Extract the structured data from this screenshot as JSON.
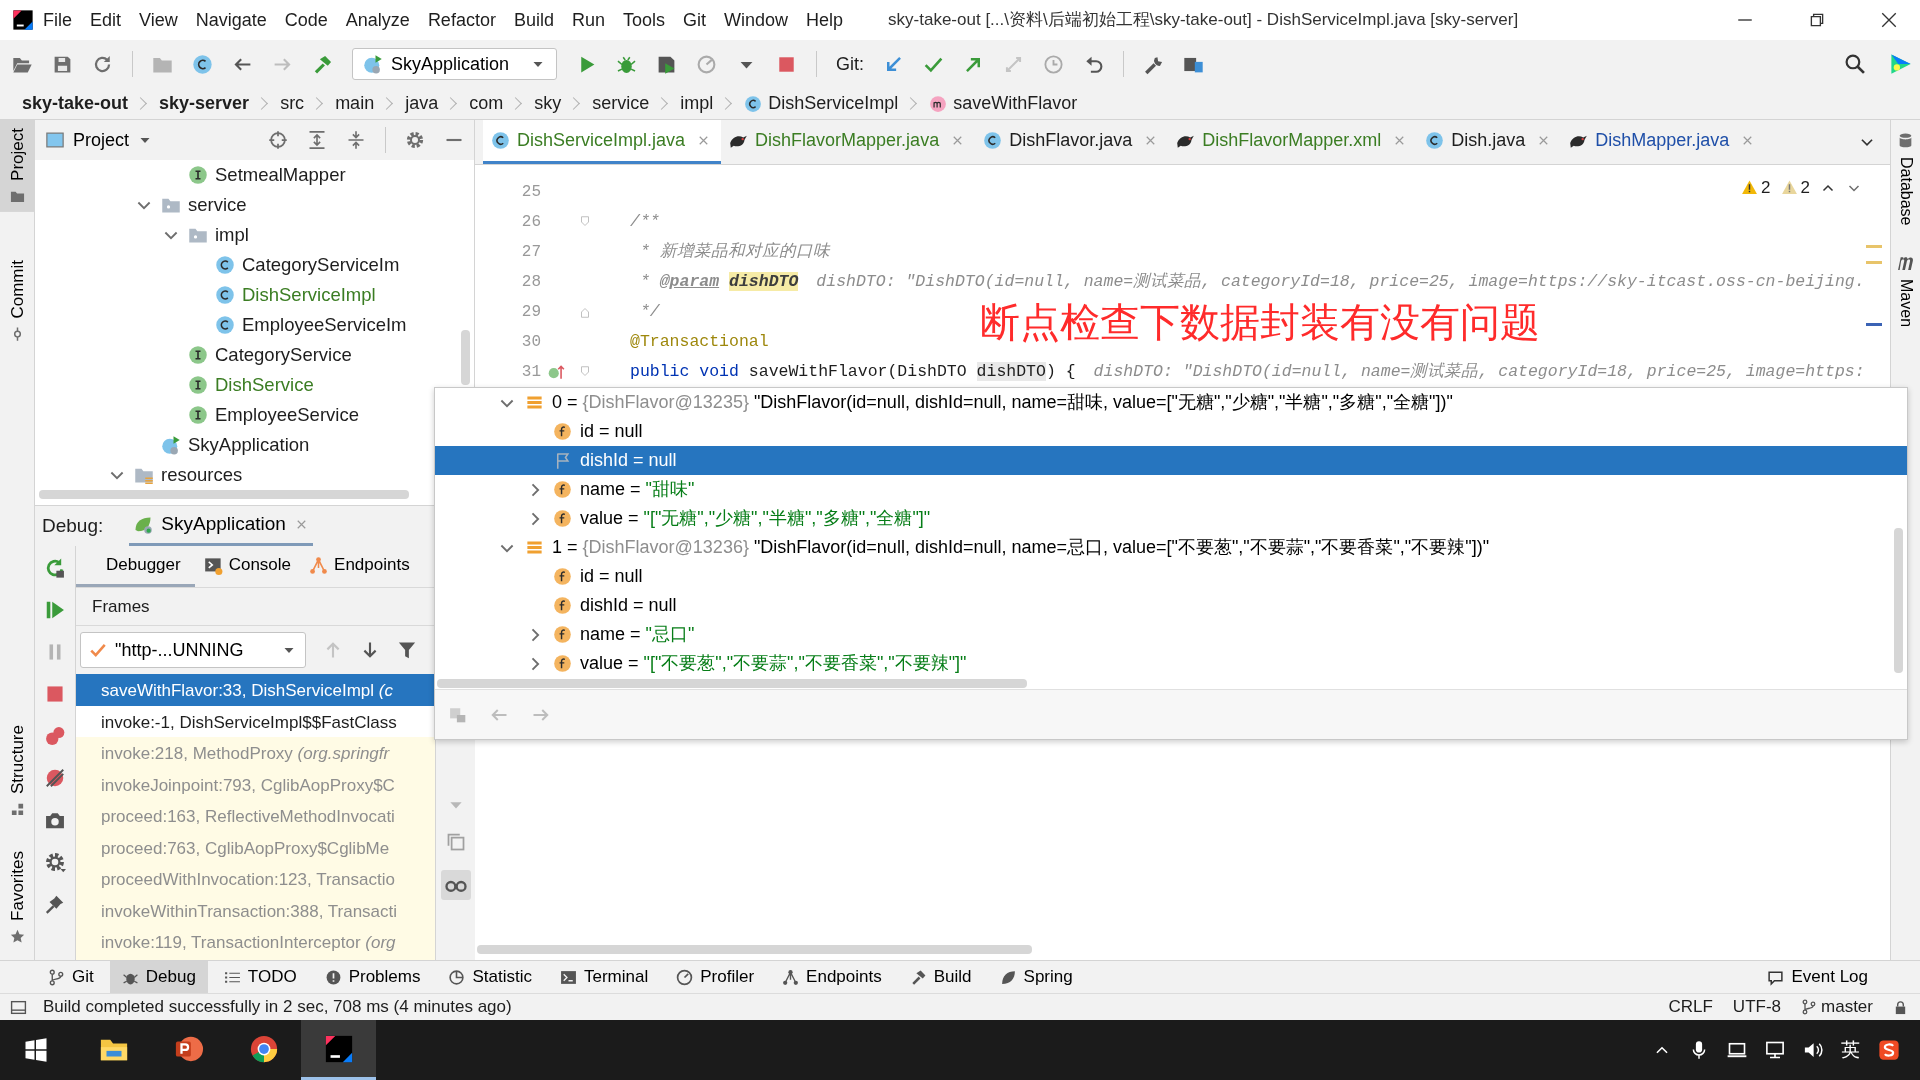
{
  "window": {
    "title": "sky-take-out [...\\资料\\后端初始工程\\sky-take-out] - DishServiceImpl.java [sky-server]"
  },
  "menu": [
    "File",
    "Edit",
    "View",
    "Navigate",
    "Code",
    "Analyze",
    "Refactor",
    "Build",
    "Run",
    "Tools",
    "Git",
    "Window",
    "Help"
  ],
  "toolbar": {
    "run_config": "SkyApplication",
    "git_label": "Git:"
  },
  "breadcrumbs": [
    {
      "label": "sky-take-out",
      "kind": "module"
    },
    {
      "label": "sky-server",
      "kind": "module"
    },
    {
      "label": "src",
      "kind": "folder"
    },
    {
      "label": "main",
      "kind": "folder"
    },
    {
      "label": "java",
      "kind": "folder"
    },
    {
      "label": "com",
      "kind": "folder"
    },
    {
      "label": "sky",
      "kind": "folder"
    },
    {
      "label": "service",
      "kind": "folder"
    },
    {
      "label": "impl",
      "kind": "folder"
    },
    {
      "label": "DishServiceImpl",
      "kind": "class"
    },
    {
      "label": "saveWithFlavor",
      "kind": "method"
    }
  ],
  "left_stripe": {
    "top": [
      {
        "label": "Project",
        "selected": true,
        "kind": "project"
      },
      {
        "label": "Commit",
        "selected": false,
        "kind": "commit"
      }
    ],
    "bottom": [
      {
        "label": "Structure",
        "selected": false,
        "kind": "structure"
      },
      {
        "label": "Favorites",
        "selected": false,
        "kind": "favorites"
      }
    ]
  },
  "right_stripe": [
    {
      "label": "Database",
      "kind": "database"
    },
    {
      "label": "Maven",
      "kind": "maven"
    }
  ],
  "project": {
    "title": "Project",
    "tree": [
      {
        "children": [
          {
            "children": [
              {
                "label": "SetmealMapper",
                "kind": "interface",
                "color": "#1e1e1e"
              }
            ]
          },
          {
            "label": "service",
            "kind": "folder",
            "color": "#1e1e1e",
            "expanded": true,
            "children": [
              {
                "label": "impl",
                "kind": "folder",
                "color": "#1e1e1e",
                "expanded": true,
                "children": [
                  {
                    "label": "CategoryServiceIm",
                    "kind": "class",
                    "color": "#1e1e1e"
                  },
                  {
                    "label": "DishServiceImpl",
                    "kind": "class",
                    "color": "#3b7d23"
                  },
                  {
                    "label": "EmployeeServiceIm",
                    "kind": "class",
                    "color": "#1e1e1e"
                  }
                ]
              },
              {
                "label": "CategoryService",
                "kind": "interface",
                "color": "#1e1e1e"
              },
              {
                "label": "DishService",
                "kind": "interface",
                "color": "#3b7d23"
              },
              {
                "label": "EmployeeService",
                "kind": "interface",
                "color": "#1e1e1e"
              }
            ]
          },
          {
            "label": "SkyApplication",
            "kind": "spring-app",
            "color": "#1e1e1e"
          }
        ]
      },
      {
        "label": "resources",
        "kind": "resources-folder",
        "color": "#1e1e1e",
        "expanded": true
      }
    ]
  },
  "editor": {
    "tabs": [
      {
        "label": "DishServiceImpl.java",
        "kind": "class",
        "selected": true,
        "color": "#3b7d23"
      },
      {
        "label": "DishFlavorMapper.java",
        "kind": "mapper",
        "selected": false,
        "color": "#3b7d23"
      },
      {
        "label": "DishFlavor.java",
        "kind": "class",
        "selected": false,
        "color": "#1e1e1e"
      },
      {
        "label": "DishFlavorMapper.xml",
        "kind": "mapper",
        "selected": false,
        "color": "#3b7d23"
      },
      {
        "label": "Dish.java",
        "kind": "class",
        "selected": false,
        "color": "#1e1e1e"
      },
      {
        "label": "DishMapper.java",
        "kind": "mapper",
        "selected": false,
        "color": "#1f4fa8"
      }
    ],
    "warnings": [
      {
        "count": "2",
        "kind": "warning"
      },
      {
        "count": "2",
        "kind": "weak-warning"
      }
    ],
    "lines": [
      {
        "number": "25"
      },
      {
        "number": "26",
        "fold_start": true,
        "segments": [
          {
            "kind": "comment",
            "text": "/**"
          }
        ]
      },
      {
        "number": "27",
        "segments": [
          {
            "kind": "comment",
            "text": " * 新增菜品和对应的口味"
          }
        ]
      },
      {
        "number": "28",
        "segments": [
          {
            "kind": "comment",
            "text": " * "
          },
          {
            "kind": "doc-tag",
            "text": "@param"
          },
          {
            "kind": "doc-param",
            "text": "dishDTO"
          }
        ],
        "hint": "dishDTO: \"DishDTO(id=null, name=测试菜品, categoryId=18, price=25, image=https://sky-itcast.oss-cn-beijing."
      },
      {
        "number": "29",
        "fold_end": true,
        "segments": [
          {
            "kind": "comment",
            "text": " */"
          }
        ]
      },
      {
        "number": "30",
        "segments": [
          {
            "kind": "annotation",
            "text": "@Transactional"
          }
        ]
      },
      {
        "number": "31",
        "fold_start": true,
        "implements": true,
        "segments": [
          {
            "kind": "keyword",
            "text": "public void "
          },
          {
            "kind": "plain",
            "text": "saveWithFlavor(DishDTO "
          },
          {
            "kind": "ref",
            "text": "dishDTO"
          },
          {
            "kind": "plain",
            "text": ") {"
          }
        ],
        "hint": "dishDTO: \"DishDTO(id=null, name=测试菜品, categoryId=18, price=25, image=https:"
      }
    ],
    "caption": "断点检查下数据封装有没有问题"
  },
  "debug": {
    "label": "Debug:",
    "session": "SkyApplication",
    "tabs": [
      {
        "label": "Debugger",
        "kind": "debugger",
        "selected": true
      },
      {
        "label": "Console",
        "kind": "console",
        "selected": false
      },
      {
        "label": "Endpoints",
        "kind": "endpoints",
        "selected": false
      }
    ],
    "frames_label": "Frames",
    "thread": "\"http-...UNNING",
    "frames": [
      {
        "text": "saveWithFlavor:33, DishServiceImpl *(c*",
        "selected": true,
        "library": false
      },
      {
        "text": "invoke:-1, DishServiceImpl$$FastClass",
        "selected": false,
        "library": false
      },
      {
        "text": "invoke:218, MethodProxy *(org.springfr*",
        "selected": false,
        "library": true
      },
      {
        "text": "invokeJoinpoint:793, CglibAopProxy$C",
        "selected": false,
        "library": true
      },
      {
        "text": "proceed:163, ReflectiveMethodInvocati",
        "selected": false,
        "library": true
      },
      {
        "text": "proceed:763, CglibAopProxy$CglibMe",
        "selected": false,
        "library": true
      },
      {
        "text": "proceedWithInvocation:123, Transactio",
        "selected": false,
        "library": true
      },
      {
        "text": "invokeWithinTransaction:388, Transacti",
        "selected": false,
        "library": true
      },
      {
        "text": "invoke:119, TransactionInterceptor *(org*",
        "selected": false,
        "library": true
      }
    ],
    "variables": [
      {
        "kind": "element",
        "label": "0 =",
        "type": "{DishFlavor@13235}",
        "value": "\"DishFlavor(id=null, dishId=null, name=甜味, value=[\"无糖\",\"少糖\",\"半糖\",\"多糖\",\"全糖\"])\"",
        "expanded": true,
        "selected": false,
        "children": [
          {
            "kind": "field",
            "label": "id = null",
            "selected": false
          },
          {
            "kind": "marked-field",
            "label": "dishId = null",
            "selected": true
          },
          {
            "kind": "field",
            "label": "name =",
            "value": "\"甜味\"",
            "expanded": false,
            "selected": false
          },
          {
            "kind": "field",
            "label": "value =",
            "value": "\"[\"无糖\",\"少糖\",\"半糖\",\"多糖\",\"全糖\"]\"",
            "expanded": false,
            "selected": false
          }
        ]
      },
      {
        "kind": "element",
        "label": "1 =",
        "type": "{DishFlavor@13236}",
        "value": "\"DishFlavor(id=null, dishId=null, name=忌口, value=[\"不要葱\",\"不要蒜\",\"不要香菜\",\"不要辣\"])\"",
        "expanded": true,
        "selected": false,
        "children": [
          {
            "kind": "field",
            "label": "id = null",
            "selected": false
          },
          {
            "kind": "field",
            "label": "dishId = null",
            "selected": false
          },
          {
            "kind": "field",
            "label": "name =",
            "value": "\"忌口\"",
            "expanded": false,
            "selected": false
          },
          {
            "kind": "field",
            "label": "value =",
            "value": "\"[\"不要葱\",\"不要蒜\",\"不要香菜\",\"不要辣\"]\"",
            "expanded": false,
            "selected": false
          }
        ]
      }
    ]
  },
  "tool_windows": [
    {
      "label": "Git",
      "kind": "git",
      "selected": false
    },
    {
      "label": "Debug",
      "kind": "debug",
      "selected": true
    },
    {
      "label": "TODO",
      "kind": "todo",
      "selected": false
    },
    {
      "label": "Problems",
      "kind": "problems",
      "selected": false
    },
    {
      "label": "Statistic",
      "kind": "statistic",
      "selected": false
    },
    {
      "label": "Terminal",
      "kind": "terminal",
      "selected": false
    },
    {
      "label": "Profiler",
      "kind": "profiler",
      "selected": false
    },
    {
      "label": "Endpoints",
      "kind": "endpoints",
      "selected": false
    },
    {
      "label": "Build",
      "kind": "build",
      "selected": false
    },
    {
      "label": "Spring",
      "kind": "spring",
      "selected": false
    }
  ],
  "event_log": "Event Log",
  "status": {
    "message": "Build completed successfully in 2 sec, 708 ms (4 minutes ago)",
    "line_separator": "CRLF",
    "encoding": "UTF-8",
    "branch": "master"
  },
  "taskbar": {
    "apps": [
      {
        "kind": "explorer",
        "selected": false
      },
      {
        "kind": "slides",
        "selected": false
      },
      {
        "kind": "browser",
        "selected": false
      },
      {
        "kind": "ide",
        "selected": true
      }
    ],
    "ime": "英"
  }
}
